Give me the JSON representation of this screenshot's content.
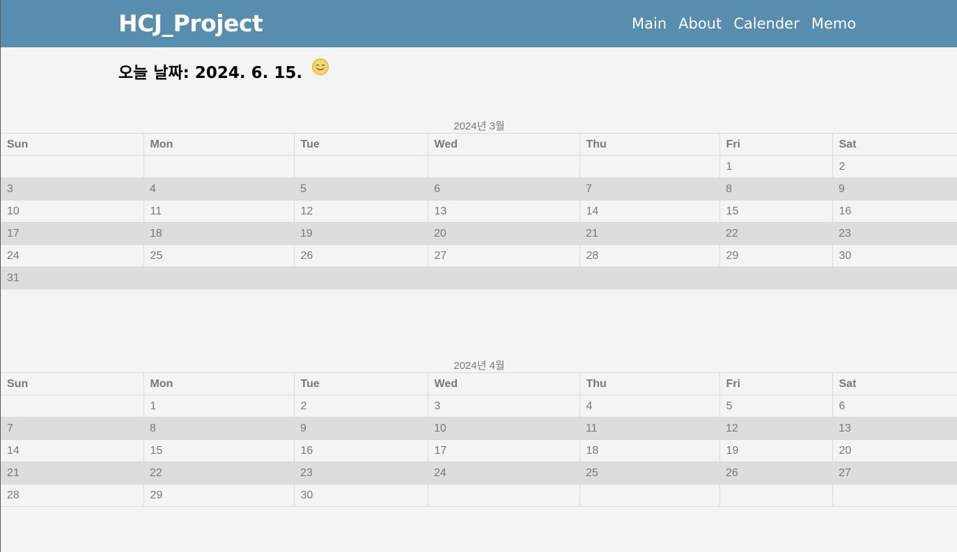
{
  "header": {
    "brand": "HCJ_Project",
    "nav": [
      "Main",
      "About",
      "Calender",
      "Memo"
    ]
  },
  "today": {
    "label": "오늘 날짜: 2024. 6. 15.",
    "icon": "smiling-face-icon"
  },
  "weekdays": [
    "Sun",
    "Mon",
    "Tue",
    "Wed",
    "Thu",
    "Fri",
    "Sat"
  ],
  "calendars": [
    {
      "caption": "2024년 3월",
      "weeks": [
        [
          "",
          "",
          "",
          "",
          "",
          "1",
          "2"
        ],
        [
          "3",
          "4",
          "5",
          "6",
          "7",
          "8",
          "9"
        ],
        [
          "10",
          "11",
          "12",
          "13",
          "14",
          "15",
          "16"
        ],
        [
          "17",
          "18",
          "19",
          "20",
          "21",
          "22",
          "23"
        ],
        [
          "24",
          "25",
          "26",
          "27",
          "28",
          "29",
          "30"
        ],
        [
          "31",
          "",
          "",
          "",
          "",
          "",
          ""
        ]
      ]
    },
    {
      "caption": "2024년 4월",
      "weeks": [
        [
          "",
          "1",
          "2",
          "3",
          "4",
          "5",
          "6"
        ],
        [
          "7",
          "8",
          "9",
          "10",
          "11",
          "12",
          "13"
        ],
        [
          "14",
          "15",
          "16",
          "17",
          "18",
          "19",
          "20"
        ],
        [
          "21",
          "22",
          "23",
          "24",
          "25",
          "26",
          "27"
        ],
        [
          "28",
          "29",
          "30",
          "",
          "",
          "",
          ""
        ]
      ]
    }
  ],
  "colors": {
    "navbar": "#578daf",
    "background": "#f4f4f5",
    "shaded_row": "#dddddd",
    "cell_text": "#777777"
  }
}
